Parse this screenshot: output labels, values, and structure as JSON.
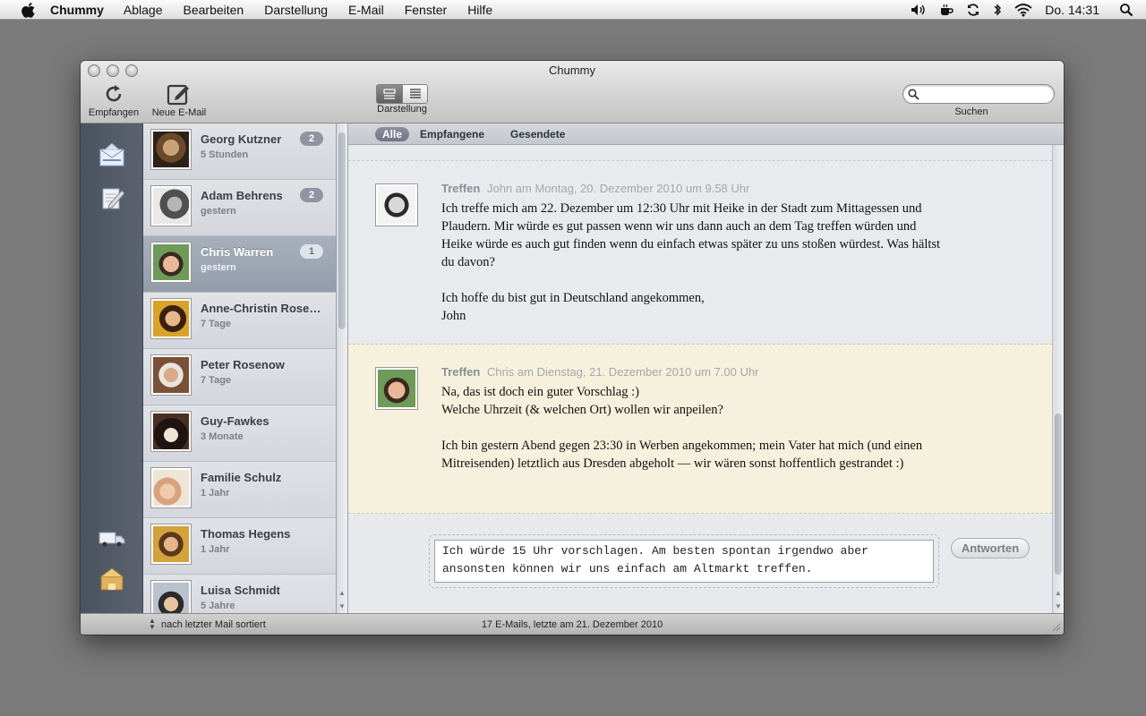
{
  "menubar": {
    "app_name": "Chummy",
    "items": [
      "Ablage",
      "Bearbeiten",
      "Darstellung",
      "E-Mail",
      "Fenster",
      "Hilfe"
    ],
    "clock": "Do. 14:31"
  },
  "window": {
    "title": "Chummy"
  },
  "toolbar": {
    "receive_label": "Empfangen",
    "new_mail_label": "Neue E-Mail",
    "view_label": "Darstellung",
    "search_label": "Suchen",
    "search_placeholder": ""
  },
  "contacts": [
    {
      "name": "Georg Kutzner",
      "time": "5 Stunden",
      "badge": "2",
      "selected": false
    },
    {
      "name": "Adam Behrens",
      "time": "gestern",
      "badge": "2",
      "selected": false
    },
    {
      "name": "Chris Warren",
      "time": "gestern",
      "badge": "1",
      "selected": true
    },
    {
      "name": "Anne-Christin Rose…",
      "time": "7 Tage",
      "badge": "",
      "selected": false
    },
    {
      "name": "Peter Rosenow",
      "time": "7 Tage",
      "badge": "",
      "selected": false
    },
    {
      "name": "Guy-Fawkes",
      "time": "3 Monate",
      "badge": "",
      "selected": false
    },
    {
      "name": "Familie Schulz",
      "time": "1 Jahr",
      "badge": "",
      "selected": false
    },
    {
      "name": "Thomas Hegens",
      "time": "1 Jahr",
      "badge": "",
      "selected": false
    },
    {
      "name": "Luisa Schmidt",
      "time": "5 Jahre",
      "badge": "",
      "selected": false
    }
  ],
  "filters": {
    "all": "Alle",
    "received": "Empfangene",
    "sent": "Gesendete"
  },
  "messages": [
    {
      "subject": "Treffen",
      "meta": "John am Montag, 20. Dezember 2010 um 9.58 Uhr",
      "paragraph1": "Ich treffe mich am 22. Dezember um 12:30 Uhr mit Heike in der Stadt zum Mittagessen und Plaudern. Mir würde es gut passen wenn wir uns dann auch an dem Tag treffen würden und Heike würde es auch gut finden wenn du einfach etwas später zu uns stoßen würdest. Was hältst du davon?",
      "paragraph2_line1": "Ich hoffe du bist gut in Deutschland angekommen,",
      "paragraph2_line2": "John"
    },
    {
      "subject": "Treffen",
      "meta": "Chris am Dienstag, 21. Dezember 2010 um 7.00 Uhr",
      "line1": "Na, das ist doch ein guter Vorschlag :)",
      "line2": "Welche Uhrzeit (& welchen Ort) wollen wir anpeilen?",
      "paragraph2": "Ich bin gestern Abend gegen 23:30 in Werben angekommen; mein Vater hat mich (und einen Mitreisenden) letztlich aus Dresden abgeholt — wir wären sonst hoffentlich gestrandet :)"
    }
  ],
  "reply": {
    "text": "Ich würde 15 Uhr vorschlagen. Am besten spontan irgendwo aber ansonsten können wir uns einfach am Altmarkt treffen.",
    "button_label": "Antworten"
  },
  "statusbar": {
    "sort_label": "nach letzter Mail sortiert",
    "summary": "17 E-Mails, letzte am 21. Dezember 2010"
  },
  "colors": {
    "selected_row": "#98a1ae",
    "sidebar": "#4f5664",
    "incoming_message_bg": "#f5f1dc"
  }
}
